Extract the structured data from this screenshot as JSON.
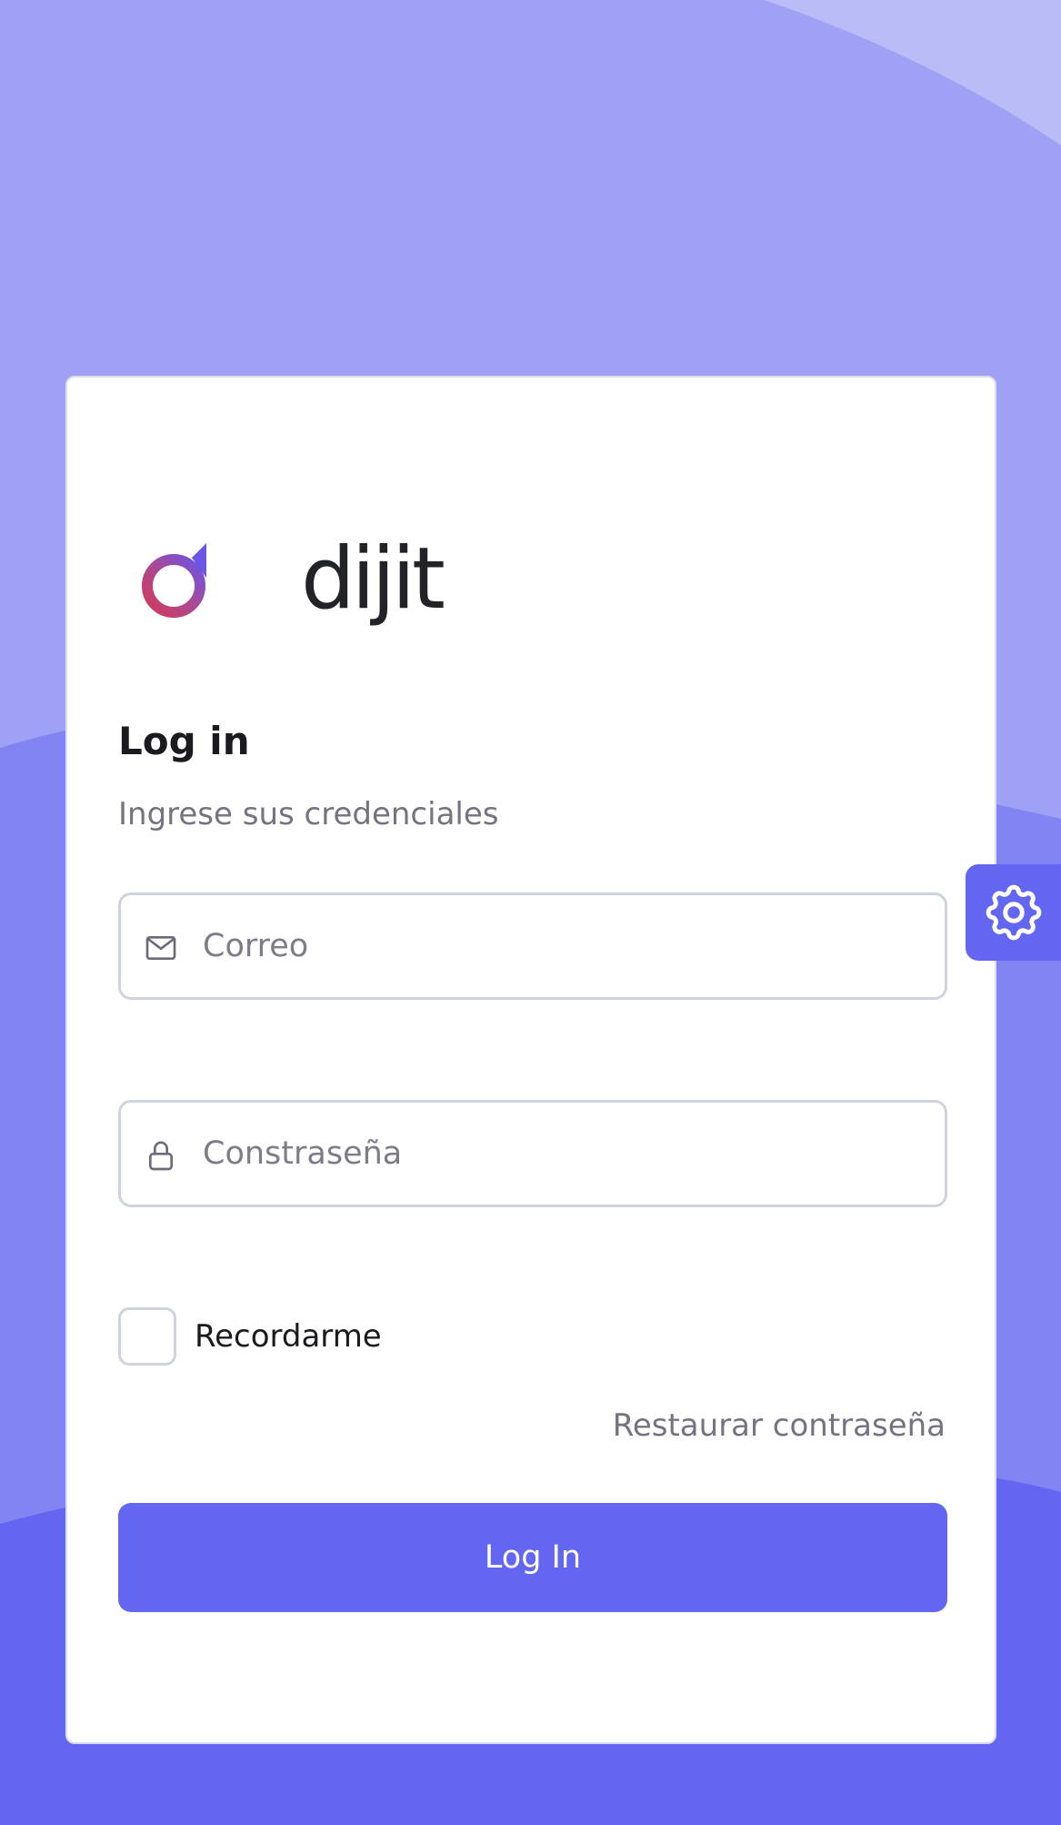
{
  "brand": {
    "name": "dijit"
  },
  "login": {
    "title": "Log in",
    "subtitle": "Ingrese sus credenciales",
    "email_placeholder": "Correo",
    "password_placeholder": "Constraseña",
    "remember_label": "Recordarme",
    "remember_checked": false,
    "restore_link": "Restaurar contraseña",
    "submit_label": "Log In"
  },
  "icons": {
    "email": "mail-icon",
    "password": "lock-icon",
    "settings": "gear-icon"
  },
  "colors": {
    "accent": "#6366f1",
    "background_light": "#9fa2f4",
    "background_mid": "#8184f2",
    "card": "#ffffff",
    "muted_text": "#737480"
  }
}
